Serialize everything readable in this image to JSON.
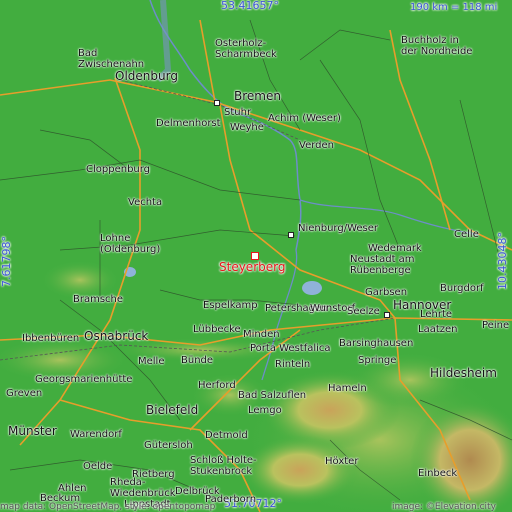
{
  "coords": {
    "top": "53.41657°",
    "bottom": "51.70712°",
    "left": "7.61798°",
    "right": "10.43048°"
  },
  "scale": "190 km = 118 mi",
  "attribution": {
    "left": "map data: OpenStreetMap, style: opentopomap",
    "right": "image: ©Elevation.city"
  },
  "highlight": "Steyerberg",
  "labels": {
    "bad_zwischenahn": "Bad\nZwischenahn",
    "oldenburg": "Oldenburg",
    "bremen": "Bremen",
    "osterholz": "Osterholz-\nScharmbeck",
    "buchholz": "Buchholz in\nder Nordheide",
    "stuhr": "Stuhr",
    "delmenhorst": "Delmenhorst",
    "weyhe": "Weyhe",
    "achim": "Achim (Weser)",
    "verden": "Verden",
    "cloppenburg": "Cloppenburg",
    "vechta": "Vechta",
    "nienburg": "Nienburg/Weser",
    "celle": "Celle",
    "lohne": "Lohne\n(Oldenburg)",
    "wedemark": "Wedemark",
    "neustadt": "Neustadt am\nRübenberge",
    "bramsche": "Bramsche",
    "espelkamp": "Espelkamp",
    "petershagen": "Petershagen",
    "wunstorf": "Wunstorf",
    "seelze": "Seelze",
    "garbsen": "Garbsen",
    "burgdorf": "Burgdorf",
    "hannover": "Hannover",
    "lehrte": "Lehrte",
    "ibbenburen": "Ibbenbüren",
    "osnabruck": "Osnabrück",
    "lubbecke": "Lübbecke",
    "minden": "Minden",
    "laatzen": "Laatzen",
    "peine": "Peine",
    "barsinghausen": "Barsinghausen",
    "georgsmarienhutte": "Georgsmarienhütte",
    "melle": "Melle",
    "bunde": "Bünde",
    "porta": "Porta Westfalica",
    "rinteln": "Rinteln",
    "springe": "Springe",
    "hildesheim": "Hildesheim",
    "hameln": "Hameln",
    "greven": "Greven",
    "herford": "Herford",
    "bad_salzuflen": "Bad Salzuflen",
    "lemgo": "Lemgo",
    "bielefeld": "Bielefeld",
    "munster": "Münster",
    "warendorf": "Warendorf",
    "detmold": "Detmold",
    "gutersloh": "Gütersloh",
    "oelde": "Oelde",
    "rietberg": "Rietberg",
    "schloss": "Schloß Holte-\nStukenbrock",
    "hoxter": "Höxter",
    "einbeck": "Einbeck",
    "rheda": "Rheda-\nWiedenbrück",
    "ahlen": "Ahlen",
    "beckum": "Beckum",
    "lippstadt": "Lippstadt",
    "paderborn": "Paderborn",
    "delbruck": "Delbrück"
  }
}
